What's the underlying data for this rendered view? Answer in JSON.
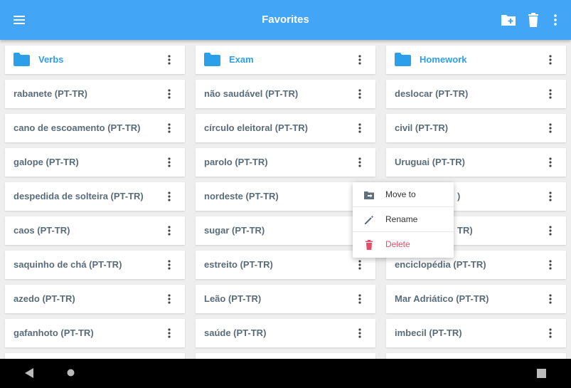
{
  "appbar": {
    "title": "Favorites",
    "menu_icon": "hamburger-menu-icon",
    "new_folder_icon": "new-folder-icon",
    "delete_icon": "trash-icon",
    "overflow_icon": "more-vert-icon"
  },
  "colors": {
    "appbar": "#42a5f5",
    "folder": "#2c9fea",
    "text": "#5a6b7a",
    "delete": "#e84b6a",
    "background": "#eeeeee"
  },
  "columns": [
    {
      "folder": "Verbs",
      "items": [
        "rabanete (PT-TR)",
        "cano de escoamento (PT-TR)",
        "galope (PT-TR)",
        "despedida de solteira (PT-TR)",
        "caos (PT-TR)",
        "saquinho de chá (PT-TR)",
        "azedo (PT-TR)",
        "gafanhoto (PT-TR)"
      ]
    },
    {
      "folder": "Exam",
      "items": [
        "não saudável (PT-TR)",
        "círculo eleitoral (PT-TR)",
        "parolo (PT-TR)",
        "nordeste (PT-TR)",
        "sugar (PT-TR)",
        "estreito (PT-TR)",
        "Leão (PT-TR)",
        "saúde (PT-TR)"
      ]
    },
    {
      "folder": "Homework",
      "items": [
        "deslocar (PT-TR)",
        "civil (PT-TR)",
        "Uruguai (PT-TR)",
        "",
        "",
        "enciclopédia (PT-TR)",
        "Mar Adriático (PT-TR)",
        "imbecil (PT-TR)"
      ],
      "partial_labels": {
        "3": ")",
        "4": "TR)"
      }
    }
  ],
  "context_menu": {
    "move_label": "Move to",
    "rename_label": "Rename",
    "delete_label": "Delete"
  },
  "navbar": {
    "back_icon": "back-triangle-icon",
    "home_icon": "home-circle-icon",
    "recents_icon": "recents-square-icon"
  }
}
